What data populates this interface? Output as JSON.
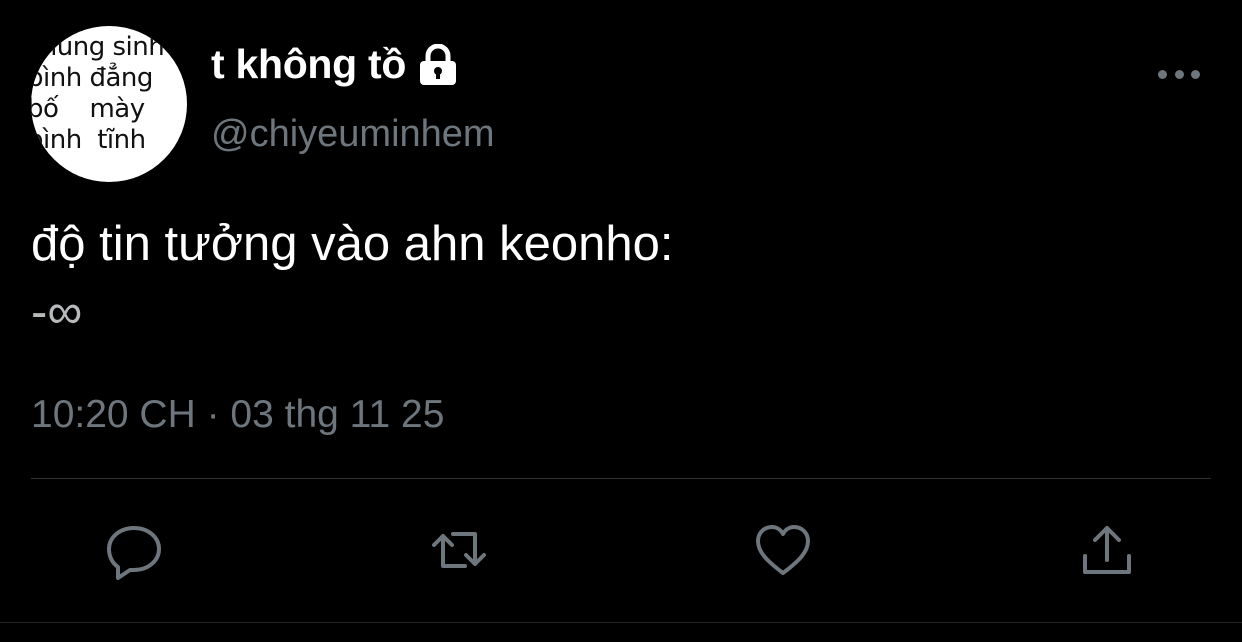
{
  "tweet": {
    "avatar_lines": [
      "chúng sinh",
      "bình đẳng",
      "bố    mày",
      "bình  tĩnh"
    ],
    "display_name": "t không tồ",
    "handle": "@chiyeuminhem",
    "text_line1": "độ tin tưởng vào ahn keonho:",
    "text_line2": "-∞",
    "timestamp": "10:20 CH · 03 thg 11 25",
    "locked_icon": "lock-icon"
  },
  "actions": {
    "reply": "reply-icon",
    "retweet": "retweet-icon",
    "like": "heart-icon",
    "share": "share-icon"
  },
  "colors": {
    "background": "#000000",
    "primary_text": "#ffffff",
    "secondary_text": "#6e767d",
    "divider": "#2f3336"
  }
}
